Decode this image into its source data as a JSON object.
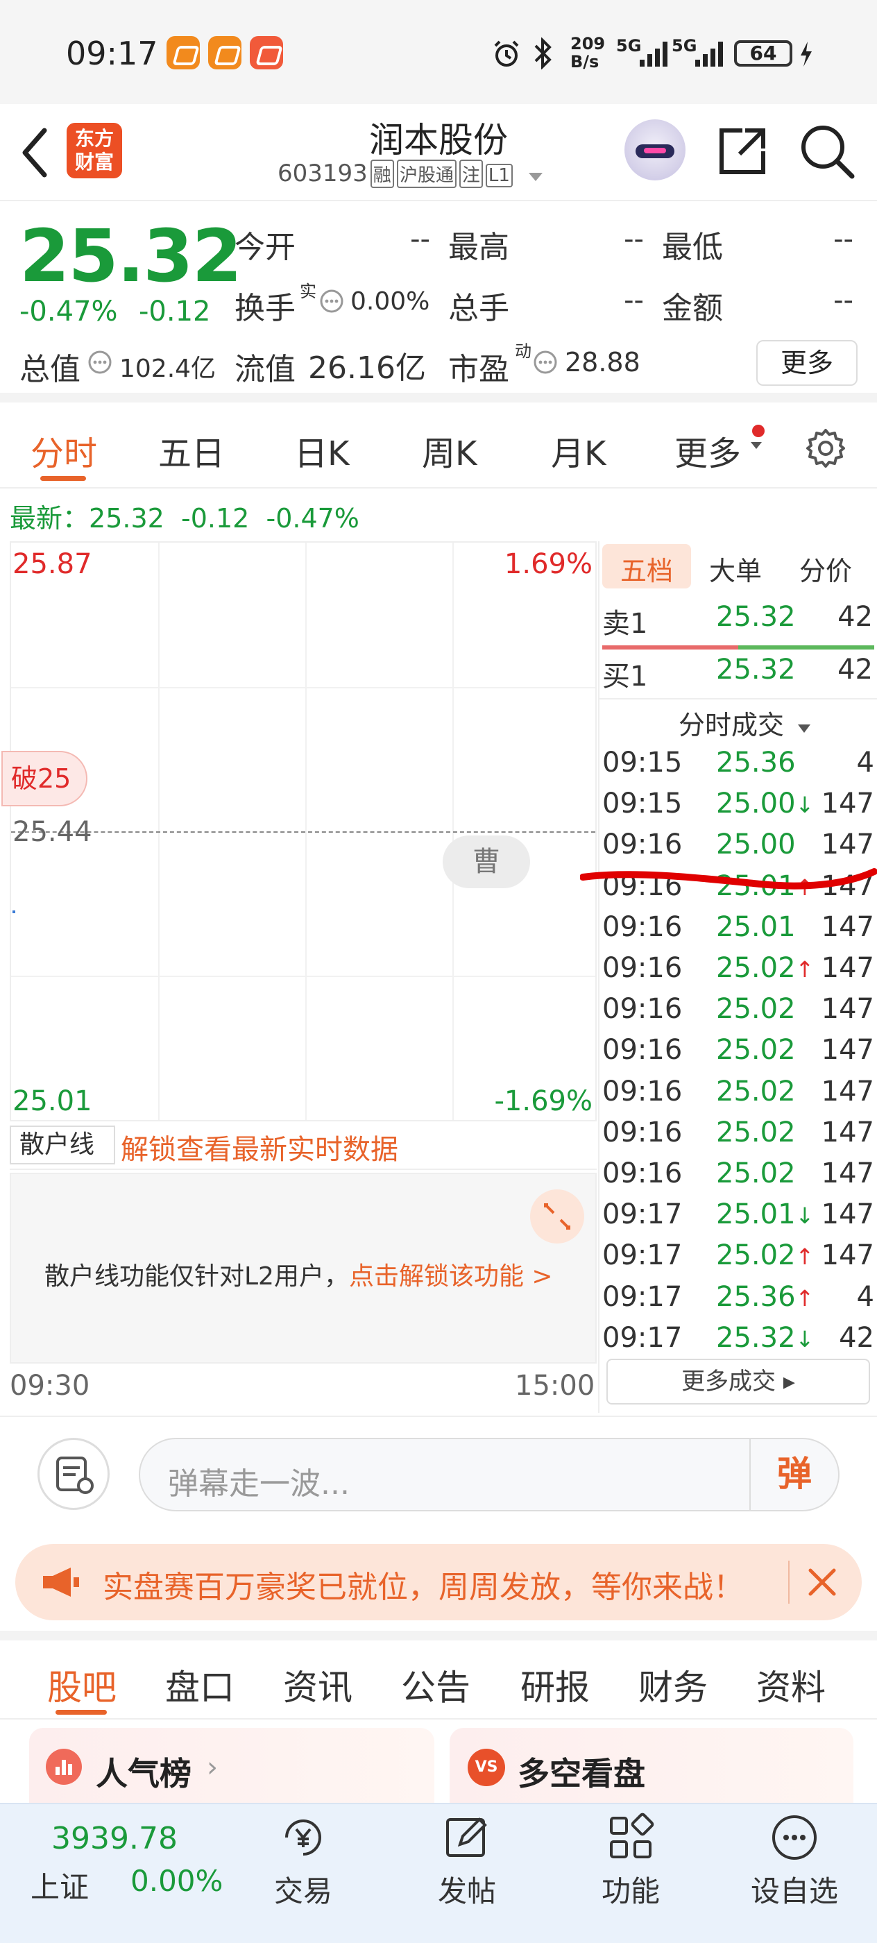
{
  "status_bar": {
    "time": "09:17",
    "net_speed_top": "209",
    "net_speed_bottom": "B/s",
    "signal1": "5G",
    "signal2": "5G",
    "battery": "64"
  },
  "header": {
    "logo_text_line1": "东方",
    "logo_text_line2": "财富",
    "stock_name": "润本股份",
    "stock_code": "603193",
    "tags": [
      "融",
      "沪股通",
      "注",
      "L1"
    ]
  },
  "quote": {
    "price": "25.32",
    "change_pct": "-0.47%",
    "change": "-0.12",
    "open_label": "今开",
    "open_value": "--",
    "high_label": "最高",
    "high_value": "--",
    "low_label": "最低",
    "low_value": "--",
    "turnover_label": "换手",
    "turnover_sup": "实",
    "turnover_value": "0.00%",
    "volume_label": "总手",
    "volume_value": "--",
    "amount_label": "金额",
    "amount_value": "--",
    "mcap_label": "总值",
    "mcap_value": "102.4亿",
    "float_label": "流值",
    "float_value": "26.16亿",
    "pe_label": "市盈",
    "pe_sup": "动",
    "pe_value": "28.88",
    "more_label": "更多"
  },
  "chart_tabs": [
    "分时",
    "五日",
    "日K",
    "周K",
    "月K",
    "更多"
  ],
  "latest": {
    "label": "最新：",
    "price": "25.32",
    "change": "-0.12",
    "pct": "-0.47%"
  },
  "chart": {
    "top_price": "25.87",
    "top_pct": "1.69%",
    "mid_price": "25.44",
    "bottom_price": "25.01",
    "bottom_pct": "-1.69%",
    "break_label": "破25",
    "bubble_label": "曹",
    "time_start": "09:30",
    "time_end": "15:00",
    "retail_line_label": "散户线",
    "unlock_text": "解锁查看最新实时数据",
    "l2_note": "散户线功能仅针对L2用户，",
    "l2_link": "点击解锁该功能 >"
  },
  "orderbook": {
    "tabs": [
      "五档",
      "大单",
      "分价"
    ],
    "sell1": {
      "label": "卖1",
      "price": "25.32",
      "vol": "42"
    },
    "buy1": {
      "label": "买1",
      "price": "25.32",
      "vol": "42"
    },
    "trades_title": "分时成交",
    "trades": [
      {
        "time": "09:15",
        "price": "25.36",
        "arrow": "",
        "vol": "4"
      },
      {
        "time": "09:15",
        "price": "25.00",
        "arrow": "↓",
        "vol": "147"
      },
      {
        "time": "09:16",
        "price": "25.00",
        "arrow": "",
        "vol": "147"
      },
      {
        "time": "09:16",
        "price": "25.01",
        "arrow": "↑",
        "vol": "147"
      },
      {
        "time": "09:16",
        "price": "25.01",
        "arrow": "",
        "vol": "147"
      },
      {
        "time": "09:16",
        "price": "25.02",
        "arrow": "↑",
        "vol": "147"
      },
      {
        "time": "09:16",
        "price": "25.02",
        "arrow": "",
        "vol": "147"
      },
      {
        "time": "09:16",
        "price": "25.02",
        "arrow": "",
        "vol": "147"
      },
      {
        "time": "09:16",
        "price": "25.02",
        "arrow": "",
        "vol": "147"
      },
      {
        "time": "09:16",
        "price": "25.02",
        "arrow": "",
        "vol": "147"
      },
      {
        "time": "09:16",
        "price": "25.02",
        "arrow": "",
        "vol": "147"
      },
      {
        "time": "09:17",
        "price": "25.01",
        "arrow": "↓",
        "vol": "147"
      },
      {
        "time": "09:17",
        "price": "25.02",
        "arrow": "↑",
        "vol": "147"
      },
      {
        "time": "09:17",
        "price": "25.36",
        "arrow": "↑",
        "vol": "4"
      },
      {
        "time": "09:17",
        "price": "25.32",
        "arrow": "↓",
        "vol": "42"
      }
    ],
    "more_trades": "更多成交"
  },
  "danmaku": {
    "placeholder": "弹幕走一波...",
    "send_label": "弹"
  },
  "banner": {
    "text": "实盘赛百万豪奖已就位，周周发放，等你来战！"
  },
  "sub_tabs": [
    "股吧",
    "盘口",
    "资讯",
    "公告",
    "研报",
    "财务",
    "资料"
  ],
  "cards": {
    "popular": "人气榜",
    "bull_bear": "多空看盘"
  },
  "bottom_nav": {
    "index_value": "3939.78",
    "index_name": "上证",
    "index_pct": "0.00%",
    "items": [
      "交易",
      "发帖",
      "功能",
      "设自选"
    ]
  },
  "colors": {
    "accent": "#e8632a",
    "down": "#1a9a3a",
    "up": "#e02a2a"
  }
}
